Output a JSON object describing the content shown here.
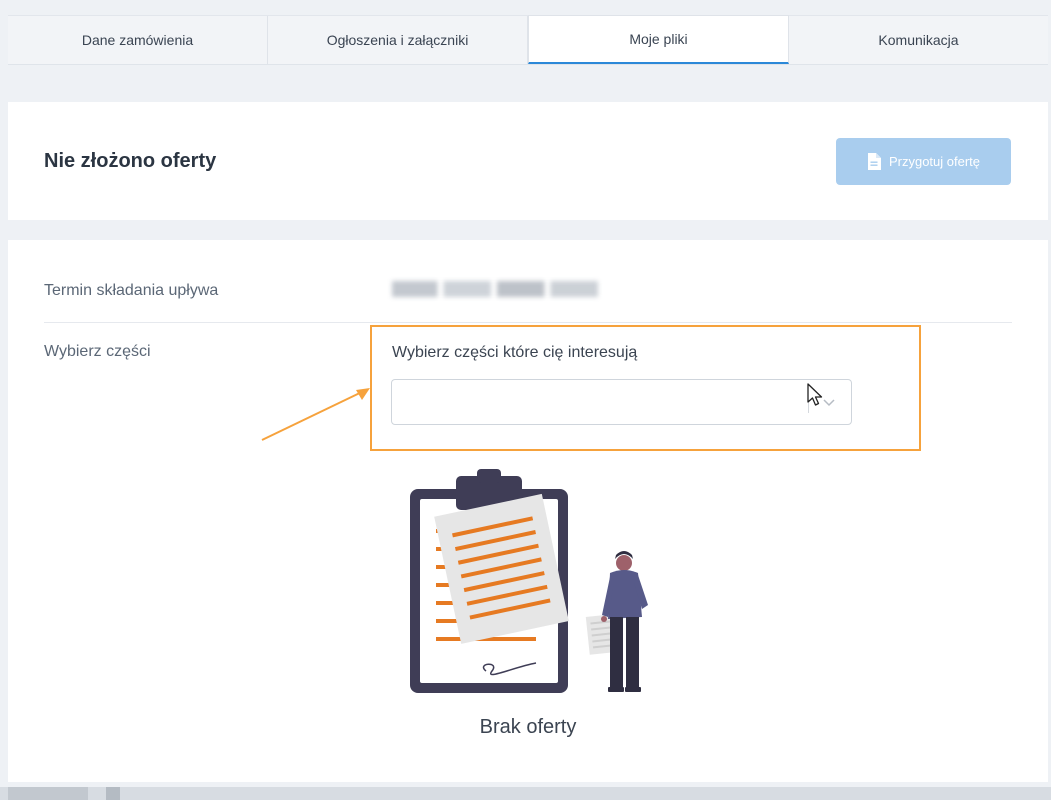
{
  "tabs": [
    {
      "label": "Dane zamówienia",
      "active": false
    },
    {
      "label": "Ogłoszenia i załączniki",
      "active": false
    },
    {
      "label": "Moje pliki",
      "active": true
    },
    {
      "label": "Komunikacja",
      "active": false
    }
  ],
  "header": {
    "title": "Nie złożono oferty",
    "action_button": {
      "label": "Przygotuj ofertę",
      "icon": "document-icon",
      "disabled": true
    }
  },
  "form": {
    "deadline": {
      "label": "Termin składania upływa",
      "value_obscured": true
    },
    "parts": {
      "label": "Wybierz części",
      "select_label": "Wybierz części które cię interesują",
      "selected_value": ""
    }
  },
  "empty_state": {
    "text": "Brak oferty",
    "illustration": "clipboard-person-illustration"
  },
  "colors": {
    "accent": "#2b88d8",
    "button_disabled": "#a9cdee",
    "highlight": "#f6a23c",
    "illustration_orange": "#e67a22",
    "clipboard_dark": "#3f3d56",
    "person_blue": "#575a89"
  }
}
